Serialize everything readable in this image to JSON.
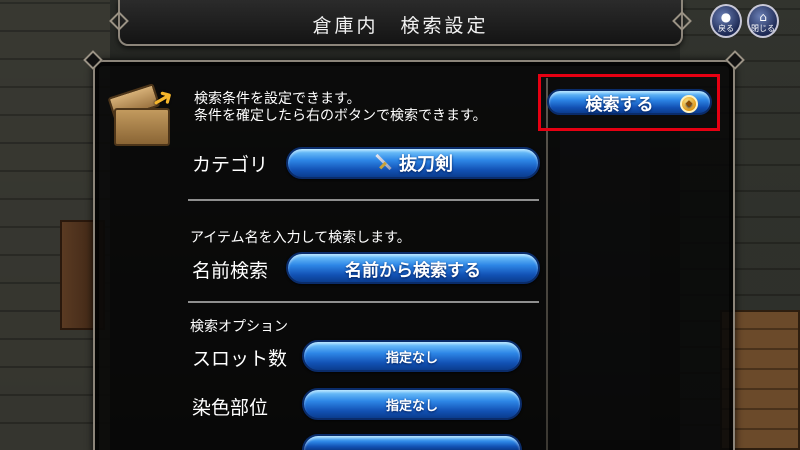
{
  "title": "倉庫内　検索設定",
  "top_buttons": {
    "back_label": "戻る",
    "close_label": "閉じる"
  },
  "panel": {
    "info_lines": [
      "検索条件を設定できます。",
      "条件を確定したら右のボタンで検索できます。"
    ],
    "search_button_label": "検索する",
    "category": {
      "label": "カテゴリ",
      "value": "抜刀剣",
      "icon": "sword-icon"
    },
    "name_search": {
      "note": "アイテム名を入力して検索します。",
      "label": "名前検索",
      "button_label": "名前から検索する"
    },
    "options": {
      "heading": "検索オプション",
      "rows": [
        {
          "label": "スロット数",
          "value": "指定なし"
        },
        {
          "label": "染色部位",
          "value": "指定なし"
        }
      ]
    }
  },
  "colors": {
    "highlight": "#e60012",
    "button_blue": "#1f6fd6",
    "panel_border": "#8c857a"
  }
}
